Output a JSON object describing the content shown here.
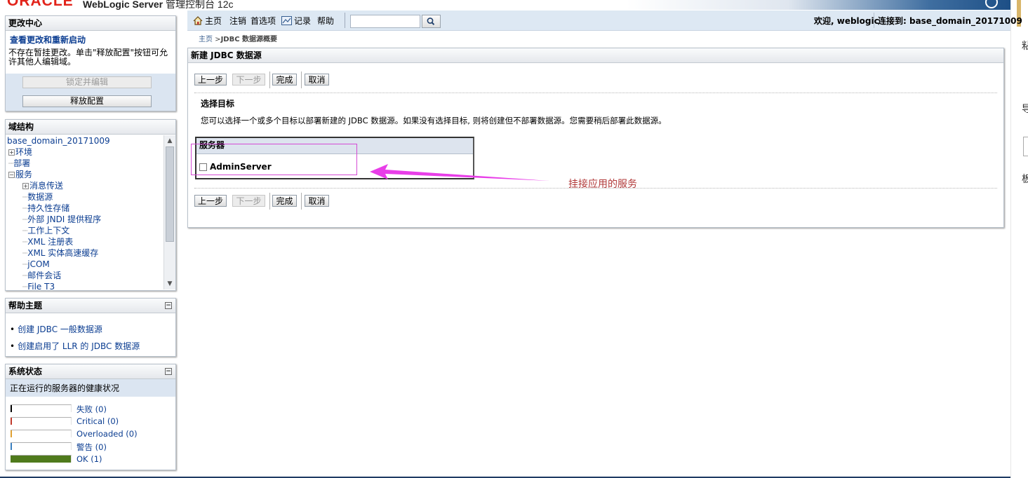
{
  "banner": {
    "logo": "ORACLE",
    "product_bold": "WebLogic Server",
    "product_rest": " 管理控制台 12c"
  },
  "change_center": {
    "title": "更改中心",
    "link": "查看更改和重新启动",
    "description": "不存在暂挂更改。单击\"释放配置\"按钮可允许其他人编辑域。",
    "lock_button": "锁定并编辑",
    "release_button": "释放配置"
  },
  "domain_structure": {
    "title": "域结构",
    "items": [
      {
        "label": "base_domain_20171009",
        "indent": 0,
        "expander": ""
      },
      {
        "label": "环境",
        "indent": 0,
        "expander": "+"
      },
      {
        "label": "部署",
        "indent": 0,
        "expander": ""
      },
      {
        "label": "服务",
        "indent": 0,
        "expander": "-"
      },
      {
        "label": "消息传送",
        "indent": 1,
        "expander": "+"
      },
      {
        "label": "数据源",
        "indent": 1,
        "expander": ""
      },
      {
        "label": "持久性存储",
        "indent": 1,
        "expander": ""
      },
      {
        "label": "外部 JNDI 提供程序",
        "indent": 1,
        "expander": ""
      },
      {
        "label": "工作上下文",
        "indent": 1,
        "expander": ""
      },
      {
        "label": "XML 注册表",
        "indent": 1,
        "expander": ""
      },
      {
        "label": "XML 实体高速缓存",
        "indent": 1,
        "expander": ""
      },
      {
        "label": "jCOM",
        "indent": 1,
        "expander": ""
      },
      {
        "label": "邮件会话",
        "indent": 1,
        "expander": ""
      },
      {
        "label": "File T3",
        "indent": 1,
        "expander": ""
      }
    ]
  },
  "help_topics": {
    "title": "帮助主题",
    "items": [
      "创建 JDBC 一般数据源",
      "创建启用了 LLR 的 JDBC 数据源"
    ]
  },
  "system_status": {
    "title": "系统状态",
    "subtitle": "正在运行的服务器的健康状况",
    "rows": [
      {
        "label": "失败 (0)",
        "color": "#000000",
        "fraction": 0
      },
      {
        "label": "Critical (0)",
        "color": "#c0392b",
        "fraction": 0
      },
      {
        "label": "Overloaded (0)",
        "color": "#e0a030",
        "fraction": 0
      },
      {
        "label": "警告 (0)",
        "color": "#3a7fc0",
        "fraction": 0
      },
      {
        "label": "OK (1)",
        "color": "#4f7a1c",
        "fraction": 1
      }
    ]
  },
  "navbar": {
    "home": "主页",
    "logout": "注销",
    "preferences": "首选项",
    "record": "记录",
    "help": "帮助",
    "search_value": "",
    "welcome": "欢迎, weblogic",
    "connected": "连接到: base_domain_20171009"
  },
  "breadcrumb": {
    "home": "主页",
    "separator": " >",
    "current": "JDBC 数据源概要"
  },
  "main": {
    "title": "新建 JDBC 数据源",
    "buttons": {
      "back": "上一步",
      "next": "下一步",
      "finish": "完成",
      "cancel": "取消"
    },
    "section_title": "选择目标",
    "section_desc": "您可以选择一个或多个目标以部署新建的 JDBC 数据源。如果没有选择目标, 则将创建但不部署数据源。您需要稍后部署此数据源。",
    "table_header": "服务器",
    "server_name": "AdminServer"
  },
  "annotation": {
    "text": "挂接应用的服务",
    "color": "#d44bd4"
  },
  "right_edge": {
    "frag1": "粘",
    "frag2": "导",
    "frag3": "板"
  }
}
